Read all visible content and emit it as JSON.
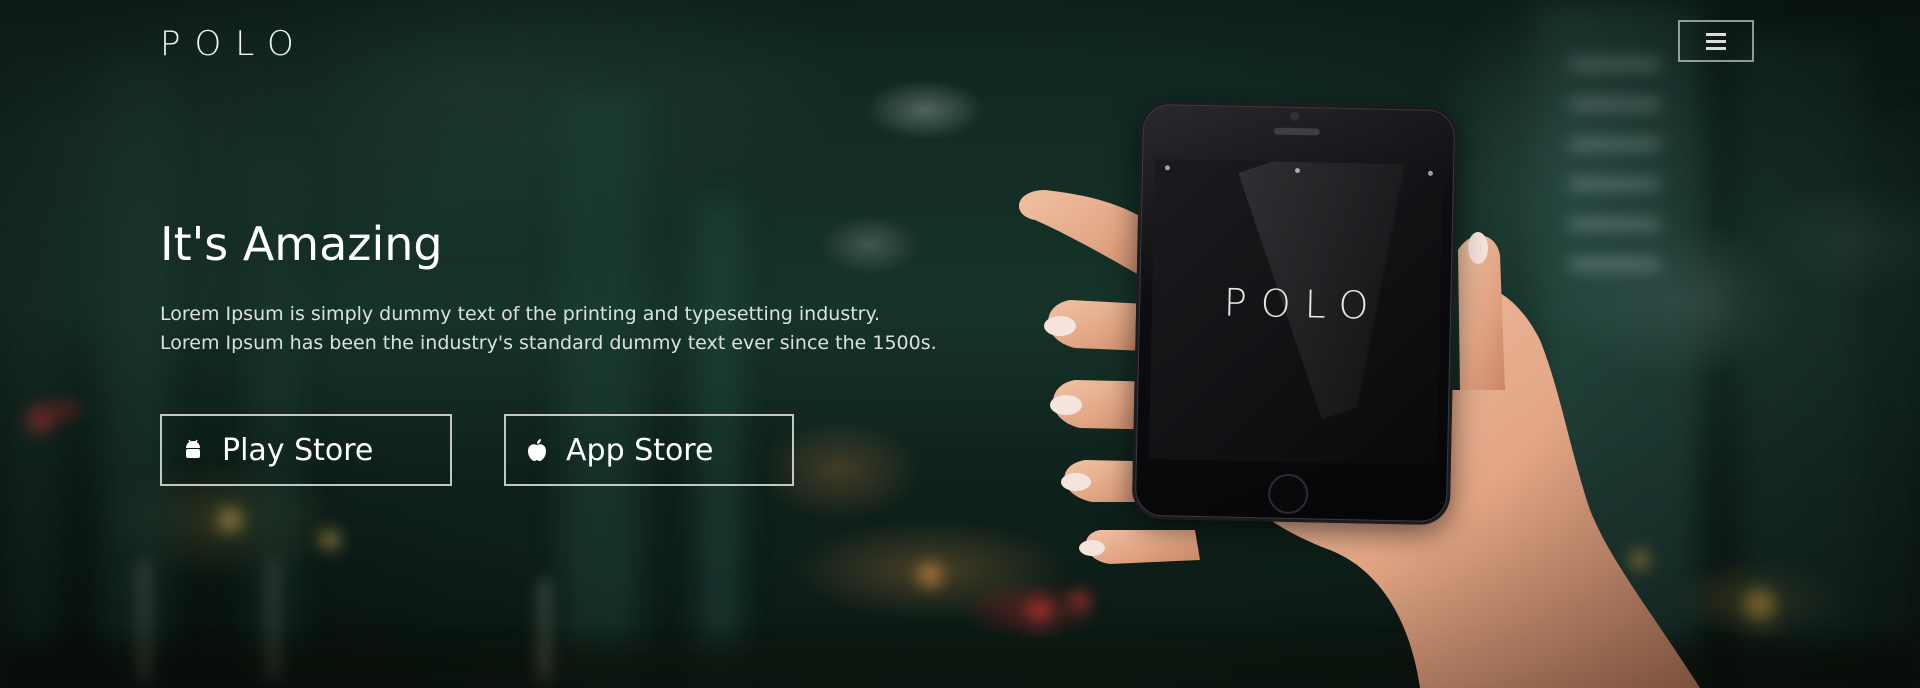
{
  "header": {
    "logo": "POLO",
    "menu_icon": "hamburger-menu-icon"
  },
  "hero": {
    "title": "It's Amazing",
    "description": "Lorem Ipsum is simply dummy text of the printing and typesetting industry. Lorem Ipsum has been the industry's standard dummy text ever since the 1500s.",
    "buttons": [
      {
        "label": "Play Store",
        "icon": "android-icon"
      },
      {
        "label": "App Store",
        "icon": "apple-icon"
      }
    ]
  },
  "device": {
    "screen_logo": "POLO"
  },
  "colors": {
    "background": "#163329",
    "text": "#ffffff",
    "button_border": "#ffffff"
  }
}
